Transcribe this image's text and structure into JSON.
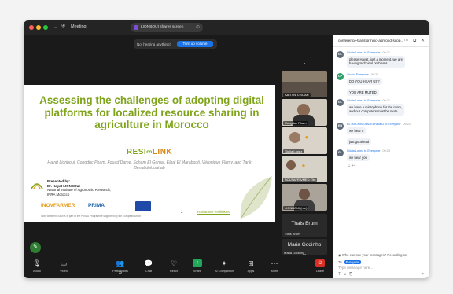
{
  "titlebar": {
    "title": "Meeting",
    "share_pill": "LIONBOUI shares screen"
  },
  "notification": {
    "text": "Not hearing anything?",
    "button": "Turn up volume"
  },
  "slide": {
    "title": "Assessing the challenges of adopting digital platforms for localized resource sharing in agriculture in Morocco",
    "brand_left": "RESI",
    "brand_right": "LINK",
    "authors": "Hayat Lionboui, Congduc Pham, Fouad Dame, Soham El Garnal, Elhaj El Marabouti, Véronique Flamy, and Tarik Benabdelouahab",
    "presented_label": "Presented by:",
    "presenter": "Dr. Hayat LIONBOUI",
    "institute": "National Institute of Agronomic Research,",
    "country": "INRA Morocco",
    "logo1": "INOVFARMER",
    "logo2": "PRIMA",
    "footnote": "InovFarmer/RESILINK is part of the PRIMA Programme supported by the European Union",
    "page_number": "2",
    "url": "inovfarmer-resilink.eu"
  },
  "participants": [
    {
      "name": "AAIT/INIT/Z/DAR"
    },
    {
      "name": "Congduc Pham"
    },
    {
      "name": "Giulia Lopez"
    },
    {
      "name": "BOUTAFRA/MED (Te)"
    },
    {
      "name": "LIONBOUI (me)"
    }
  ],
  "named_tiles": [
    {
      "big": "Thais Brum",
      "small": "Thais Brum"
    },
    {
      "big": "Maria Godinho",
      "small": "Maria Godinho"
    }
  ],
  "chat": {
    "header": "conference-transforming-agrifood-supp...",
    "messages": [
      {
        "initials": "GL",
        "from": "Giulia Lopez to Everyone",
        "time": "09:21",
        "lines": [
          "please Hayat, just a moment, we are",
          "having technical problems"
        ]
      },
      {
        "initials": "CP",
        "from": "You to Everyone",
        "time": "09:21",
        "lines": [
          "DO YOU HEAR US?",
          "YOU ARE MUTED"
        ]
      },
      {
        "initials": "GL",
        "from": "Giulia Lopez to Everyone",
        "time": "09:21",
        "lines": [
          "we have a microphone for the room,",
          "and our computers must be mute"
        ]
      },
      {
        "initials": "EH",
        "from": "EL HACHIMI ABDELHAMID to Everyone",
        "time": "09:22",
        "lines": [
          "we hear u",
          "just go ahead"
        ]
      },
      {
        "initials": "GL",
        "from": "Giulia Lopez to Everyone",
        "time": "09:23",
        "lines": [
          "we hear you"
        ]
      }
    ],
    "who_can_see": "Who can see your messages? Recording on",
    "to_label": "To:",
    "to_value": "Everyone",
    "input_placeholder": "Type message here..."
  },
  "toolbar": {
    "audio": "Audio",
    "video": "Video",
    "participants": "Participants",
    "participants_count": "22",
    "chat": "Chat",
    "react": "React",
    "share": "Share",
    "ai": "AI Companion",
    "apps": "Apps",
    "more": "More",
    "leave": "Leave"
  },
  "colors": {
    "slide_green": "#7fa41b",
    "link_orange": "#d98a1c",
    "zoom_blue": "#1a73e8",
    "share_green": "#23a55a",
    "leave_red": "#d93025"
  }
}
